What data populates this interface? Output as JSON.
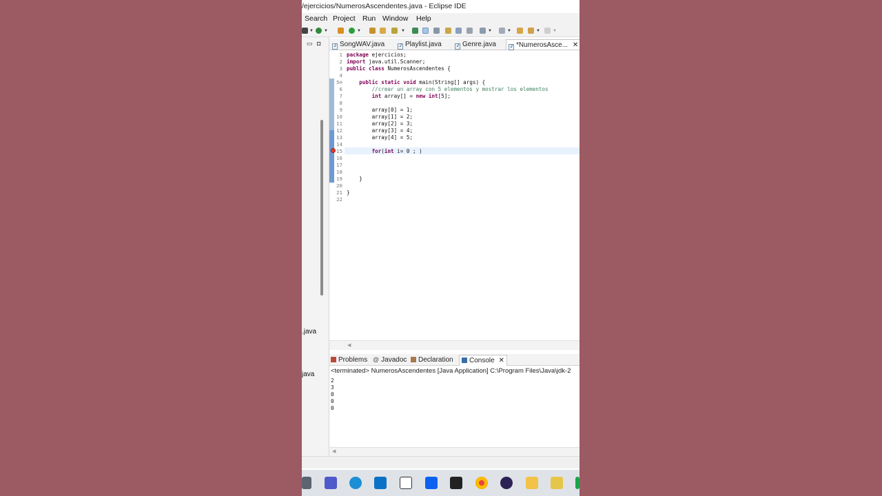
{
  "window": {
    "title": "/ejercicios/NumerosAscendentes.java - Eclipse IDE"
  },
  "menu": [
    "Search",
    "Project",
    "Run",
    "Window",
    "Help"
  ],
  "package_explorer": {
    "file_1": ".java",
    "file_2": "java"
  },
  "editor_tabs": [
    {
      "label": "SongWAV.java"
    },
    {
      "label": "Playlist.java"
    },
    {
      "label": "Genre.java"
    },
    {
      "label": "*NumerosAsce...",
      "active": true
    }
  ],
  "code_lines": [
    {
      "n": "1",
      "text": "package ejercicios;"
    },
    {
      "n": "2",
      "text": "import java.util.Scanner;"
    },
    {
      "n": "3",
      "text": "public class NumerosAscendentes {"
    },
    {
      "n": "4",
      "text": ""
    },
    {
      "n": "5⊖",
      "text": "    public static void main(String[] args) {"
    },
    {
      "n": "6",
      "text": "        //crear un array con 5 elementos y mostrar los elementos"
    },
    {
      "n": "7",
      "text": "        int array[] = new int[5];"
    },
    {
      "n": "8",
      "text": ""
    },
    {
      "n": "9",
      "text": "        array[0] = 1;"
    },
    {
      "n": "10",
      "text": "        array[1] = 2;"
    },
    {
      "n": "11",
      "text": "        array[2] = 3;"
    },
    {
      "n": "12",
      "text": "        array[3] = 4;"
    },
    {
      "n": "13",
      "text": "        array[4] = 5;"
    },
    {
      "n": "14",
      "text": ""
    },
    {
      "n": "15",
      "text": "        for(int i= 0 ; )"
    },
    {
      "n": "16",
      "text": ""
    },
    {
      "n": "17",
      "text": ""
    },
    {
      "n": "18",
      "text": ""
    },
    {
      "n": "19",
      "text": "    }"
    },
    {
      "n": "20",
      "text": ""
    },
    {
      "n": "21",
      "text": "}"
    },
    {
      "n": "22",
      "text": ""
    }
  ],
  "bottom_tabs": [
    {
      "label": "Problems"
    },
    {
      "label": "Javadoc"
    },
    {
      "label": "Declaration"
    },
    {
      "label": "Console",
      "active": true
    }
  ],
  "console": {
    "header": "<terminated> NumerosAscendentes [Java Application] C:\\Program Files\\Java\\jdk-2",
    "output": [
      "2",
      "3",
      "0",
      "0",
      "0"
    ]
  },
  "taskbar_icons": [
    "file-explorer-icon",
    "teams-icon",
    "edge-icon",
    "mail-icon",
    "amazon-icon",
    "dropbox-icon",
    "app-icon",
    "chrome-icon",
    "eclipse-icon",
    "folder-icon",
    "sticky-icon"
  ],
  "colors": {
    "background": "#9c5a62",
    "keyword": "#7f0055",
    "comment": "#3f7f5f",
    "current_line": "#e8f2fe",
    "change_bar": "#9dbad9"
  }
}
